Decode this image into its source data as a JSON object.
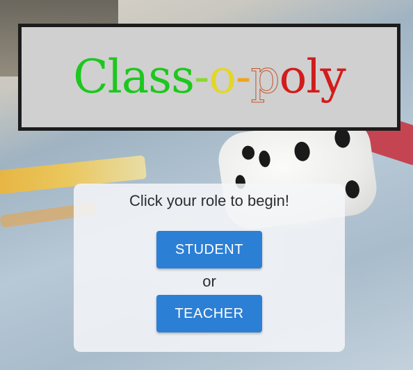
{
  "app": {
    "title_parts": [
      "Class",
      "-",
      "o",
      "-",
      "p",
      "oly"
    ],
    "colors": {
      "banner_bg": "#d0d0d0",
      "button_bg": "#2b7fd4",
      "button_text": "#ffffff"
    }
  },
  "panel": {
    "prompt": "Click your role to begin!",
    "student_label": "STUDENT",
    "or_text": "or",
    "teacher_label": "TEACHER"
  }
}
